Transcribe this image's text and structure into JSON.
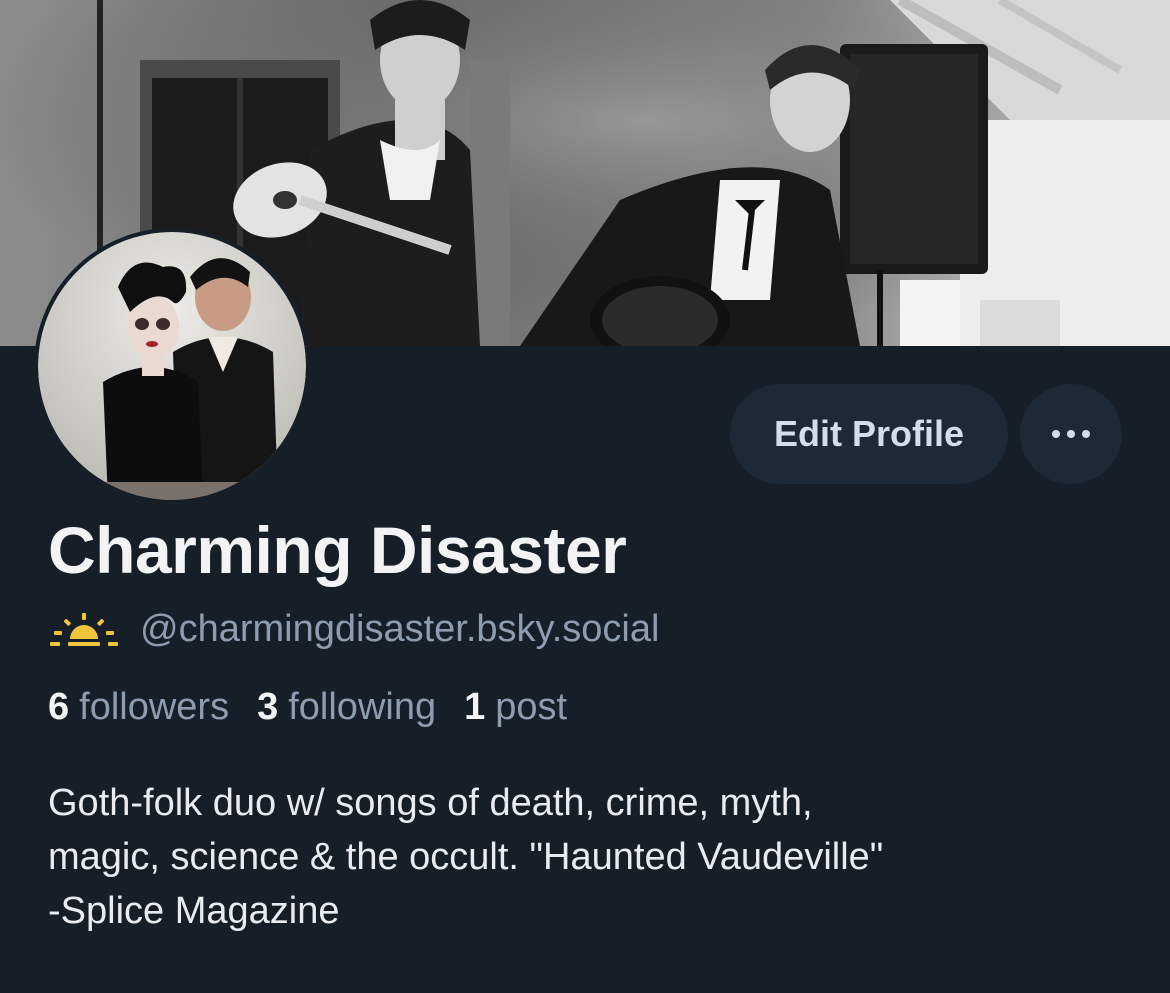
{
  "profile": {
    "display_name": "Charming Disaster",
    "handle": "@charmingdisaster.bsky.social",
    "handle_icon": "sun-rising-icon",
    "bio_lines": [
      "Goth-folk duo w/ songs of death, crime, myth,",
      "magic, science & the occult. \"Haunted Vaudeville\"",
      "-Splice Magazine"
    ]
  },
  "stats": {
    "followers_count": "6",
    "followers_label": "followers",
    "following_count": "3",
    "following_label": "following",
    "posts_count": "1",
    "posts_label": "post"
  },
  "actions": {
    "edit_label": "Edit Profile",
    "more_icon": "ellipsis-icon"
  },
  "colors": {
    "background": "#161e27",
    "button_bg": "#1e2936",
    "muted_text": "#8d9caf",
    "primary_text": "#f1f3f5",
    "sun_icon": "#f0c43a"
  }
}
